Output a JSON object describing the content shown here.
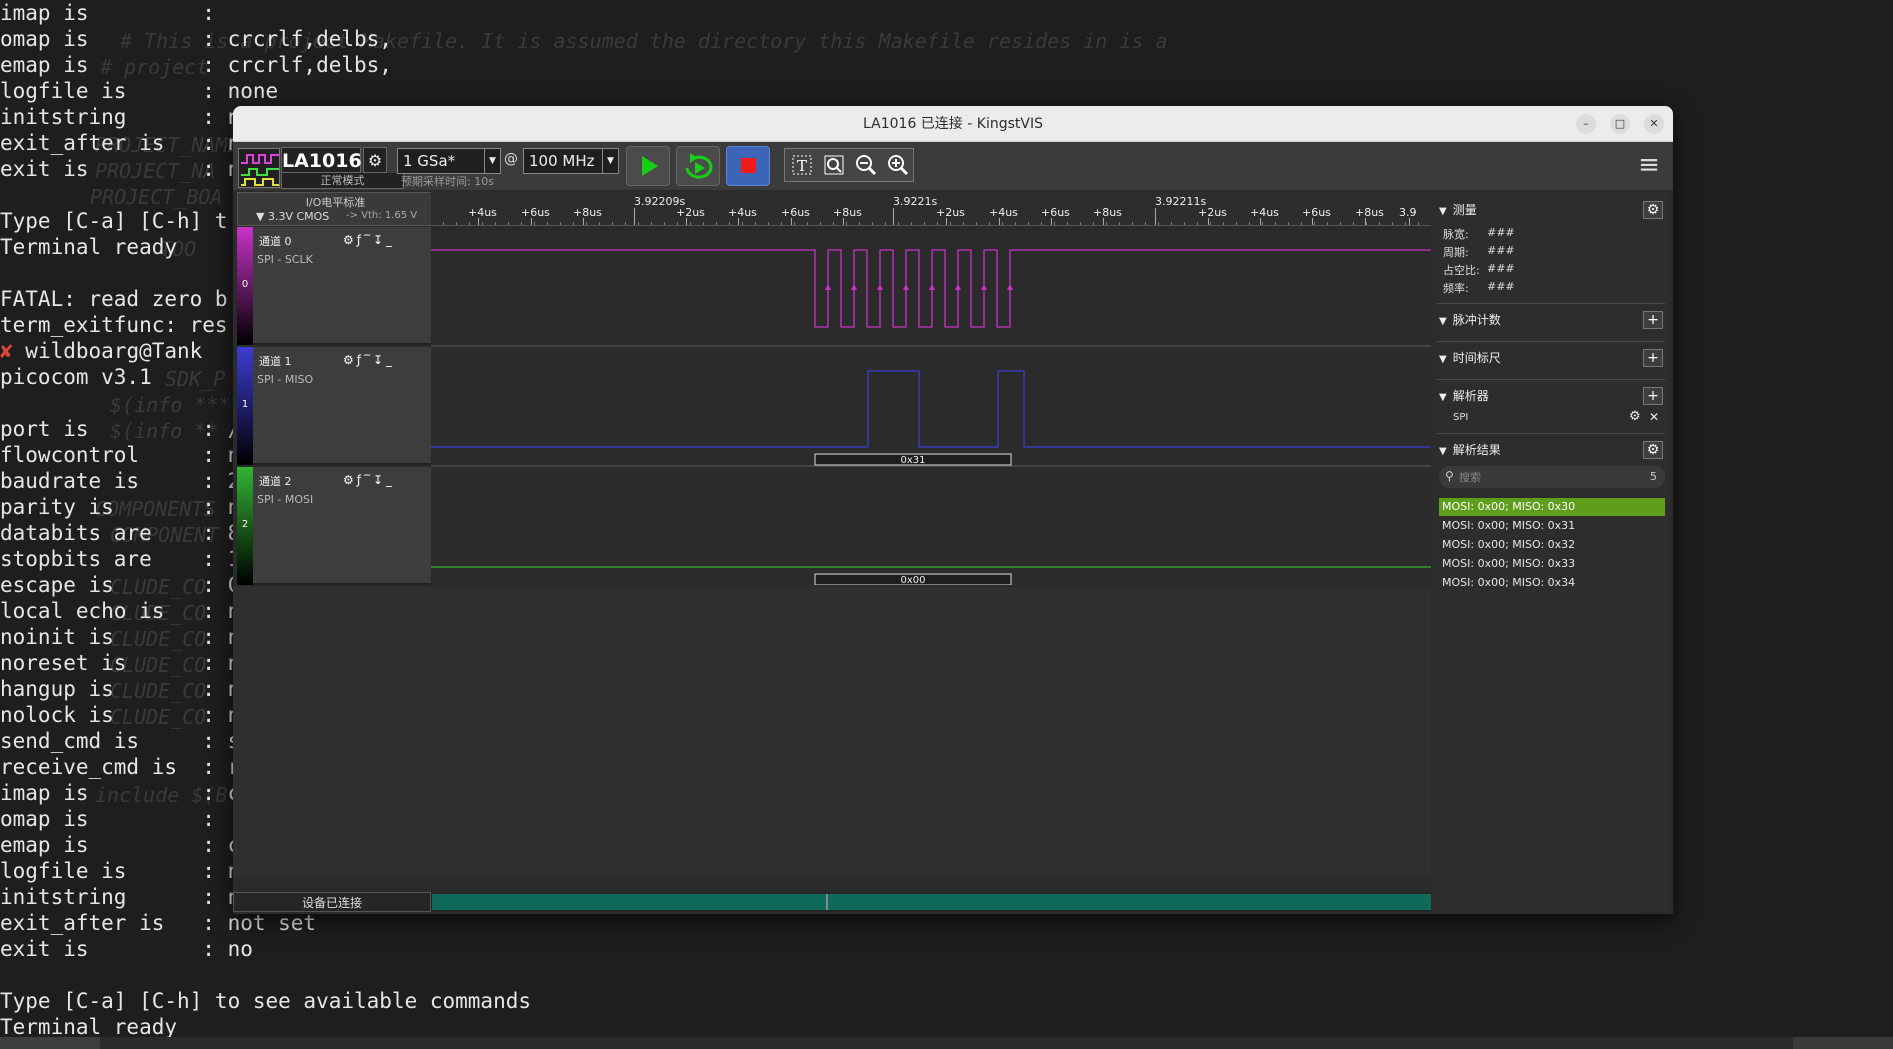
{
  "terminal": {
    "lines": [
      "imap is         :",
      "omap is         : crcrlf,delbs,",
      "emap is         : crcrlf,delbs,",
      "logfile is      : none",
      "initstring      : n",
      "exit_after is   : n",
      "exit is         : n",
      "",
      "Type [C-a] [C-h] t",
      "Terminal ready",
      "",
      "FATAL: read zero b",
      "term_exitfunc: res",
      " wildboarg@Tank",
      "picocom v3.1",
      "",
      "port is         : /",
      "flowcontrol     : n",
      "baudrate is     : 2",
      "parity is       : n",
      "databits are    : 8",
      "stopbits are    : 1",
      "escape is       : C",
      "local echo is   : n",
      "noinit is       : n",
      "noreset is      : n",
      "hangup is       : n",
      "nolock is       : n",
      "send_cmd is     : s",
      "receive_cmd is  : r",
      "imap is         : c",
      "omap is         :",
      "emap is         : c",
      "logfile is      : n",
      "initstring      : n",
      "exit_after is   : not set",
      "exit is         : no",
      "",
      "Type [C-a] [C-h] to see available commands",
      "Terminal ready"
    ],
    "error_mark": "✘",
    "ghost_lines": [
      "# This is a project Makefile. It is assumed the directory this Makefile resides in is a",
      "# project",
      "PROJECT_NAME",
      "PROJECT_NA",
      "PROJECT_BOA",
      "TOO",
      "SDK_P",
      "$(info ****",
      "$(info **",
      "COMPONENTS",
      "COMPONENT",
      "CLUDE_CO",
      "CLUDE_CO",
      "CLUDE_CO",
      "CLUDE_CO",
      "CLUDE_CO",
      "CLUDE_CO",
      "include $(B"
    ]
  },
  "window": {
    "title": "LA1016 已连接 - KingstVIS",
    "minimize_icon": "–",
    "maximize_icon": "□",
    "close_icon": "✕"
  },
  "toolbar": {
    "device_name": "LA1016",
    "device_mode": "正常模式",
    "sample_rate": "1 GSa*",
    "at": "@",
    "frequency": "100 MHz",
    "sample_time": "预期采样时间: 10s",
    "menu_icon": "≡"
  },
  "io": {
    "label": "I/O电平标准",
    "level": "▼ 3.3V CMOS",
    "vth": "-> Vth: 1.65 V"
  },
  "channels": [
    {
      "num": "0",
      "name": "通道 0",
      "desc": "SPI - SCLK",
      "color": "#c832c8"
    },
    {
      "num": "1",
      "name": "通道 1",
      "desc": "SPI - MISO",
      "color": "#3c3cd2"
    },
    {
      "num": "2",
      "name": "通道 2",
      "desc": "SPI - MOSI",
      "color": "#32b432"
    }
  ],
  "channel_tools": "⚙ƒ‾↧_",
  "ruler": {
    "ticks": [
      "+4us",
      "+6us",
      "+8us",
      "3.92209s",
      "+2us",
      "+4us",
      "+6us",
      "+8us",
      "3.9221s",
      "+2us",
      "+4us",
      "+6us",
      "+8us",
      "3.92211s",
      "+2us",
      "+4us",
      "+6us",
      "+8us",
      "3.9"
    ]
  },
  "decode": {
    "miso_value": "0x31",
    "mosi_value": "0x00"
  },
  "colors": {
    "sclk": "#c832c8",
    "miso": "#3c3cd2",
    "mosi": "#32b432",
    "selected_row": "#5e9e1a",
    "buffer": "#0f6b59"
  },
  "status": {
    "text": "设备已连接"
  },
  "side": {
    "measure": {
      "title": "测量",
      "rows": [
        {
          "label": "脉宽:",
          "value": "###"
        },
        {
          "label": "周期:",
          "value": "###"
        },
        {
          "label": "占空比:",
          "value": "###"
        },
        {
          "label": "频率:",
          "value": "###"
        }
      ]
    },
    "pulse_count": "脉冲计数",
    "time_marker": "时间标尺",
    "decoder": {
      "title": "解析器",
      "item": "SPI"
    },
    "results": {
      "title": "解析结果",
      "search_placeholder": "搜索",
      "count": "5",
      "rows": [
        "MOSI: 0x00;  MISO: 0x30",
        "MOSI: 0x00;  MISO: 0x31",
        "MOSI: 0x00;  MISO: 0x32",
        "MOSI: 0x00;  MISO: 0x33",
        "MOSI: 0x00;  MISO: 0x34"
      ]
    },
    "triangle": "▼",
    "gear": "⚙",
    "plus": "+",
    "close": "✕"
  }
}
